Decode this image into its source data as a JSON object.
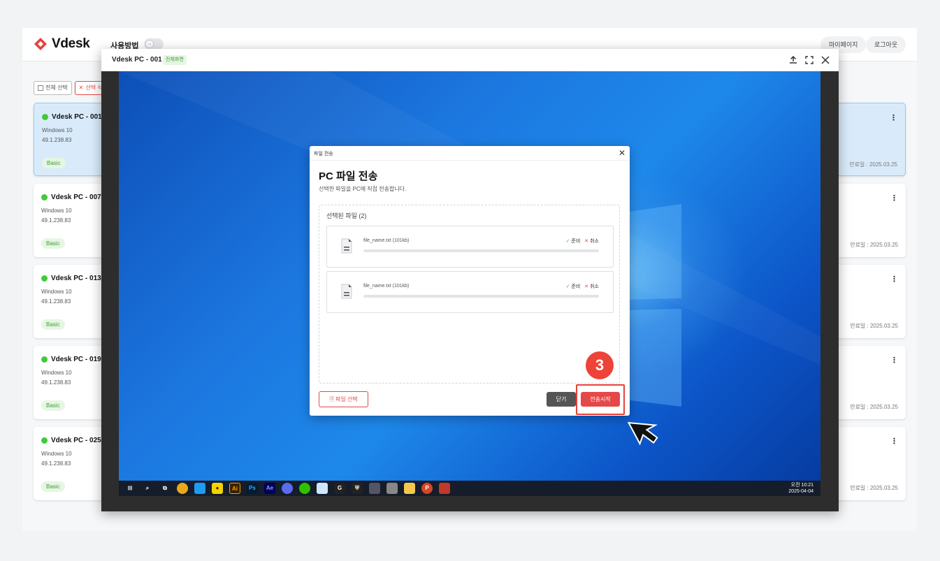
{
  "header": {
    "logo_text": "Vdesk",
    "howto_label": "사용방법",
    "mypage_label": "마이페이지",
    "logout_label": "로그아웃"
  },
  "toolbar": {
    "select_all_label": "전체 선택",
    "delete_selected_label": "선택 삭제"
  },
  "cards": [
    {
      "name": "Vdesk PC - 001",
      "os": "Windows 10",
      "ip": "49.1.238.83",
      "plan": "Basic",
      "expiry": "만료일 : 2025.03.25",
      "selected": true
    },
    {
      "name": "Vdesk PC - 007",
      "os": "Windows 10",
      "ip": "49.1.238.83",
      "plan": "Basic",
      "expiry": "만료일 : 2025.03.25"
    },
    {
      "name": "Vdesk PC - 013",
      "os": "Windows 10",
      "ip": "49.1.238.83",
      "plan": "Basic",
      "expiry": "만료일 : 2025.03.25"
    },
    {
      "name": "Vdesk PC - 019",
      "os": "Windows 10",
      "ip": "49.1.238.83",
      "plan": "Basic",
      "expiry": "만료일 : 2025.03.25"
    },
    {
      "name": "Vdesk PC - 025",
      "os": "Windows 10",
      "ip": "49.1.238.83",
      "plan": "Basic",
      "expiry": "만료일 : 2025.03.25"
    }
  ],
  "remote": {
    "title": "Vdesk PC - 001",
    "mode_badge": "전체화면",
    "clock_time": "오전 10:21",
    "clock_date": "2025-04-04"
  },
  "dialog": {
    "window_title": "파일 전송",
    "title": "PC 파일 전송",
    "subtitle": "선택한 파일을 PC에 직접 전송합니다.",
    "files_header": "선택된 파일 (2)",
    "files": [
      {
        "name": "file_name.txt  (101kb)",
        "status": "준비",
        "cancel": "취소",
        "progress": 0
      },
      {
        "name": "file_name.txt  (101kb)",
        "status": "준비",
        "cancel": "취소",
        "progress": 0
      }
    ],
    "select_file_label": "파일 선택",
    "close_label": "닫기",
    "start_label": "전송시작"
  },
  "annotation": {
    "step_number": "3"
  },
  "colors": {
    "accent": "#e54848",
    "online": "#42c93a",
    "badge_bg": "#e6f6e3",
    "desktop_blue": "#1c78e0"
  }
}
